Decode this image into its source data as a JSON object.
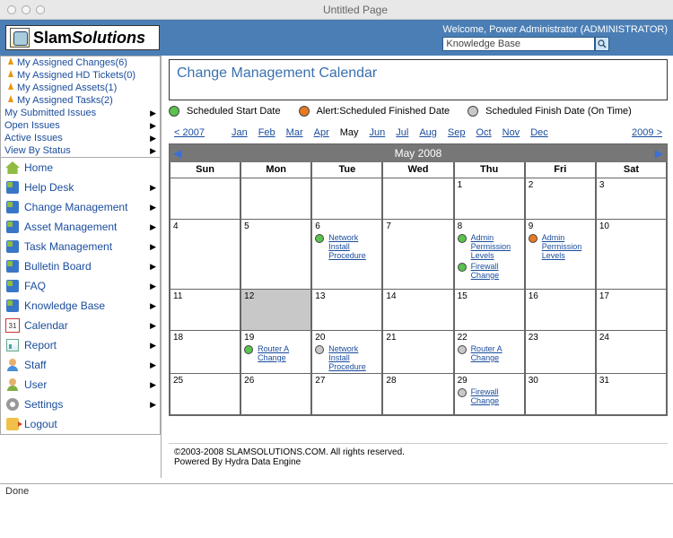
{
  "window": {
    "title": "Untitled Page"
  },
  "brand": {
    "name_bold": "Slam",
    "name_rest": "Solutions"
  },
  "top": {
    "welcome": "Welcome, Power Administrator (ADMINISTRATOR)",
    "search_value": "Knowledge Base"
  },
  "sidebar": {
    "assigned": [
      {
        "label": "My Assigned Changes(6)"
      },
      {
        "label": "My Assigned HD Tickets(0)"
      },
      {
        "label": "My Assigned Assets(1)"
      },
      {
        "label": "My Assigned Tasks(2)"
      }
    ],
    "issues": [
      {
        "label": "My Submitted Issues"
      },
      {
        "label": "Open Issues"
      },
      {
        "label": "Active Issues"
      },
      {
        "label": "View By Status"
      }
    ],
    "nav": [
      {
        "label": "Home",
        "icon": "home-icon",
        "arrow": false
      },
      {
        "label": "Help Desk",
        "icon": "cube-icon",
        "arrow": true
      },
      {
        "label": "Change Management",
        "icon": "cube-icon",
        "arrow": true
      },
      {
        "label": "Asset Management",
        "icon": "cube-icon",
        "arrow": true
      },
      {
        "label": "Task Management",
        "icon": "cube-icon",
        "arrow": true
      },
      {
        "label": "Bulletin Board",
        "icon": "cube-icon",
        "arrow": true
      },
      {
        "label": "FAQ",
        "icon": "cube-icon",
        "arrow": true
      },
      {
        "label": "Knowledge Base",
        "icon": "cube-icon",
        "arrow": true
      },
      {
        "label": "Calendar",
        "icon": "calendar-icon",
        "arrow": true
      },
      {
        "label": "Report",
        "icon": "chart-icon",
        "arrow": true
      },
      {
        "label": "Staff",
        "icon": "person-blue-icon",
        "arrow": true
      },
      {
        "label": "User",
        "icon": "person-green-icon",
        "arrow": true
      },
      {
        "label": "Settings",
        "icon": "gear-icon",
        "arrow": true
      },
      {
        "label": "Logout",
        "icon": "logout-icon",
        "arrow": false
      }
    ]
  },
  "page": {
    "title": "Change Management Calendar"
  },
  "legend": {
    "a": "Scheduled Start Date",
    "b": "Alert:Scheduled Finished Date",
    "c": "Scheduled Finish Date (On Time)"
  },
  "yearnav": {
    "prev_year": "< 2007",
    "months": [
      "Jan",
      "Feb",
      "Mar",
      "Apr",
      "May",
      "Jun",
      "Jul",
      "Aug",
      "Sep",
      "Oct",
      "Nov",
      "Dec"
    ],
    "current_month_index": 4,
    "next_year": "2009 >"
  },
  "calendar": {
    "title": "May 2008",
    "dow": [
      "Sun",
      "Mon",
      "Tue",
      "Wed",
      "Thu",
      "Fri",
      "Sat"
    ],
    "weeks": [
      [
        {
          "d": ""
        },
        {
          "d": ""
        },
        {
          "d": ""
        },
        {
          "d": ""
        },
        {
          "d": "1"
        },
        {
          "d": "2"
        },
        {
          "d": "3"
        }
      ],
      [
        {
          "d": "4"
        },
        {
          "d": "5"
        },
        {
          "d": "6",
          "events": [
            {
              "color": "green",
              "label": "Network Install Procedure"
            }
          ]
        },
        {
          "d": "7"
        },
        {
          "d": "8",
          "events": [
            {
              "color": "green",
              "label": "Admin Permission Levels"
            },
            {
              "color": "green",
              "label": "Firewall Change"
            }
          ]
        },
        {
          "d": "9",
          "events": [
            {
              "color": "orange",
              "label": "Admin Permission Levels"
            }
          ]
        },
        {
          "d": "10"
        }
      ],
      [
        {
          "d": "11"
        },
        {
          "d": "12",
          "today": true
        },
        {
          "d": "13"
        },
        {
          "d": "14"
        },
        {
          "d": "15"
        },
        {
          "d": "16"
        },
        {
          "d": "17"
        }
      ],
      [
        {
          "d": "18"
        },
        {
          "d": "19",
          "events": [
            {
              "color": "green",
              "label": "Router A Change"
            }
          ]
        },
        {
          "d": "20",
          "events": [
            {
              "color": "gray",
              "label": "Network Install Procedure"
            }
          ]
        },
        {
          "d": "21"
        },
        {
          "d": "22",
          "events": [
            {
              "color": "gray",
              "label": "Router A Change"
            }
          ]
        },
        {
          "d": "23"
        },
        {
          "d": "24"
        }
      ],
      [
        {
          "d": "25"
        },
        {
          "d": "26"
        },
        {
          "d": "27"
        },
        {
          "d": "28"
        },
        {
          "d": "29",
          "events": [
            {
              "color": "gray",
              "label": "Firewall Change"
            }
          ]
        },
        {
          "d": "30"
        },
        {
          "d": "31"
        }
      ]
    ]
  },
  "footer": {
    "line1": "©2003-2008 SLAMSOLUTIONS.COM. All rights reserved.",
    "line2": "Powered By Hydra Data Engine"
  },
  "status": {
    "text": "Done"
  }
}
